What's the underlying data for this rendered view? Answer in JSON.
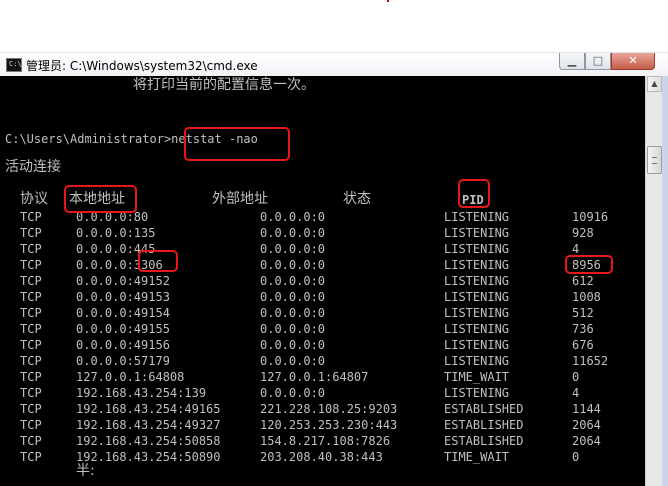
{
  "window": {
    "title": "管理员: C:\\Windows\\system32\\cmd.exe",
    "icon": "cmd-icon",
    "controls": {
      "minimize": "▁",
      "maximize": "□",
      "close": "✕"
    }
  },
  "console": {
    "intro": "将打印当前的配置信息一次。",
    "prompt": "C:\\Users\\Administrator>",
    "command": "netstat -nao",
    "section_title": "活动连接",
    "headers": {
      "proto": "协议",
      "local": "本地地址",
      "foreign": "外部地址",
      "state": "状态",
      "pid": "PID"
    },
    "rows": [
      {
        "proto": "TCP",
        "local": "0.0.0.0:80",
        "foreign": "0.0.0.0:0",
        "state": "LISTENING",
        "pid": "10916"
      },
      {
        "proto": "TCP",
        "local": "0.0.0.0:135",
        "foreign": "0.0.0.0:0",
        "state": "LISTENING",
        "pid": "928"
      },
      {
        "proto": "TCP",
        "local": "0.0.0.0:445",
        "foreign": "0.0.0.0:0",
        "state": "LISTENING",
        "pid": "4"
      },
      {
        "proto": "TCP",
        "local": "0.0.0.0:3306",
        "foreign": "0.0.0.0:0",
        "state": "LISTENING",
        "pid": "8956"
      },
      {
        "proto": "TCP",
        "local": "0.0.0.0:49152",
        "foreign": "0.0.0.0:0",
        "state": "LISTENING",
        "pid": "612"
      },
      {
        "proto": "TCP",
        "local": "0.0.0.0:49153",
        "foreign": "0.0.0.0:0",
        "state": "LISTENING",
        "pid": "1008"
      },
      {
        "proto": "TCP",
        "local": "0.0.0.0:49154",
        "foreign": "0.0.0.0:0",
        "state": "LISTENING",
        "pid": "512"
      },
      {
        "proto": "TCP",
        "local": "0.0.0.0:49155",
        "foreign": "0.0.0.0:0",
        "state": "LISTENING",
        "pid": "736"
      },
      {
        "proto": "TCP",
        "local": "0.0.0.0:49156",
        "foreign": "0.0.0.0:0",
        "state": "LISTENING",
        "pid": "676"
      },
      {
        "proto": "TCP",
        "local": "0.0.0.0:57179",
        "foreign": "0.0.0.0:0",
        "state": "LISTENING",
        "pid": "11652"
      },
      {
        "proto": "TCP",
        "local": "127.0.0.1:64808",
        "foreign": "127.0.0.1:64807",
        "state": "TIME_WAIT",
        "pid": "0"
      },
      {
        "proto": "TCP",
        "local": "192.168.43.254:139",
        "foreign": "0.0.0.0:0",
        "state": "LISTENING",
        "pid": "4"
      },
      {
        "proto": "TCP",
        "local": "192.168.43.254:49165",
        "foreign": "221.228.108.25:9203",
        "state": "ESTABLISHED",
        "pid": "1144"
      },
      {
        "proto": "TCP",
        "local": "192.168.43.254:49327",
        "foreign": "120.253.253.230:443",
        "state": "ESTABLISHED",
        "pid": "2064"
      },
      {
        "proto": "TCP",
        "local": "192.168.43.254:50858",
        "foreign": "154.8.217.108:7826",
        "state": "ESTABLISHED",
        "pid": "2064"
      },
      {
        "proto": "TCP",
        "local": "192.168.43.254:50890",
        "foreign": "203.208.40.38:443",
        "state": "TIME_WAIT",
        "pid": "0"
      }
    ],
    "last_partial": "半:"
  },
  "colors": {
    "console_bg": "#000000",
    "console_text": "#c0c0c0",
    "highlight": "#e81818"
  }
}
